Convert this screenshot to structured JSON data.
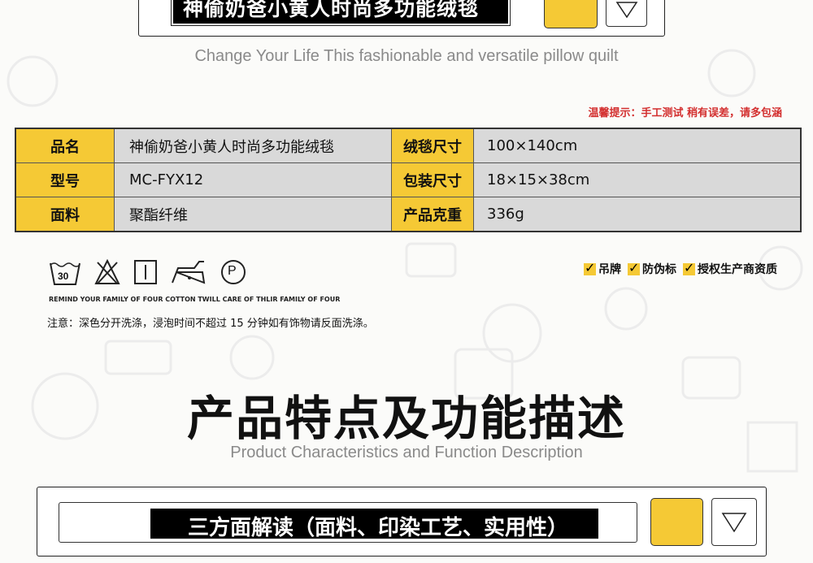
{
  "top_banner": {
    "title": "神偷奶爸小黄人时尚多功能绒毯"
  },
  "subtitle_top": "Change Your Life This fashionable and versatile pillow quilt",
  "warning": "温馨提示：手工测试 稍有误差，请多包涵",
  "spec_table": {
    "rows": [
      {
        "label1": "品名",
        "value1": "神偷奶爸小黄人时尚多功能绒毯",
        "label2": "绒毯尺寸",
        "value2": "100×140cm"
      },
      {
        "label1": "型号",
        "value1": "MC-FYX12",
        "label2": "包装尺寸",
        "value2": "18×15×38cm"
      },
      {
        "label1": "面料",
        "value1": "聚酯纤维",
        "label2": "产品克重",
        "value2": "336g"
      }
    ]
  },
  "care": {
    "icons": [
      "wash-30-icon",
      "no-bleach-icon",
      "line-dry-icon",
      "iron-low-icon",
      "dry-clean-p-icon"
    ],
    "wash_temp": "30",
    "dry_clean_letter": "P",
    "remind": "REMIND YOUR FAMILY OF FOUR COTTON TWILL CARE OF THLIR FAMILY OF FOUR",
    "note": "注意：深色分开洗涤，浸泡时间不超过 15 分钟如有饰物请反面洗涤。"
  },
  "badges": [
    "吊牌",
    "防伪标",
    "授权生产商资质"
  ],
  "section": {
    "title": "产品特点及功能描述",
    "subtitle": "Product Characteristics and Function Description"
  },
  "bottom_banner": {
    "title": "三方面解读（面料、印染工艺、实用性）"
  },
  "colors": {
    "accent": "#f5c935",
    "warning": "#d32f2f",
    "cell_gray": "#d9d9d9"
  }
}
